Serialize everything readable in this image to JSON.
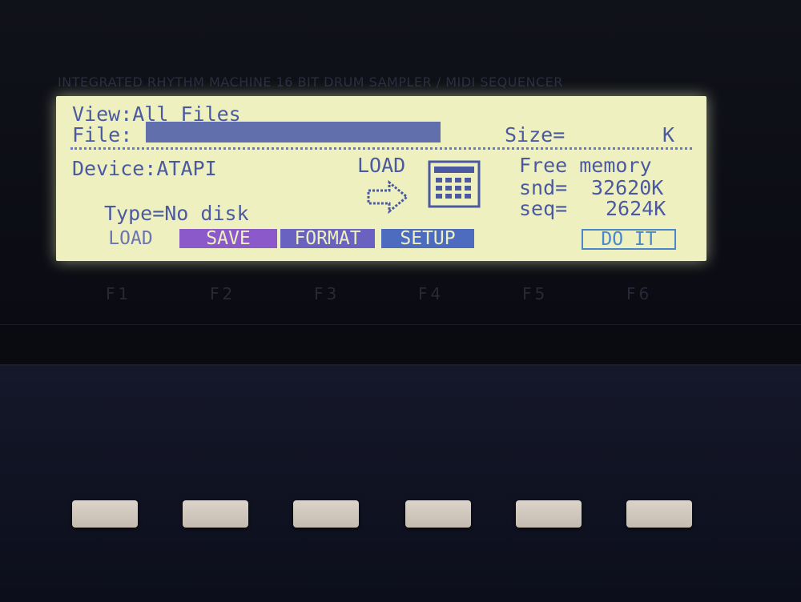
{
  "panel_label": "INTEGRATED RHYTHM MACHINE 16 BIT DRUM SAMPLER / MIDI SEQUENCER",
  "lcd": {
    "view": "View:All Files",
    "file_label": "File:",
    "size_label": "Size=",
    "size_unit": "K",
    "device": "Device:ATAPI",
    "type": "Type=No disk",
    "load_heading": "LOAD",
    "free_memory_label": "Free memory",
    "snd_label": "snd=",
    "snd_value": "32620K",
    "seq_label": "seq=",
    "seq_value": "2624K",
    "soft_keys": [
      "LOAD",
      "SAVE",
      "FORMAT",
      "SETUP",
      "DO IT"
    ]
  },
  "function_keys": [
    "F1",
    "F2",
    "F3",
    "F4",
    "F5",
    "F6"
  ],
  "colors": {
    "lcd_background": "#eef0bf",
    "lcd_text": "#4b5aa0",
    "save_tab": "#8b59c9",
    "format_tab": "#6a62c0",
    "setup_tab": "#4d6cc0",
    "doit_outline": "#4a88cc"
  },
  "icons": [
    "right-arrow-icon",
    "drum-machine-icon"
  ]
}
